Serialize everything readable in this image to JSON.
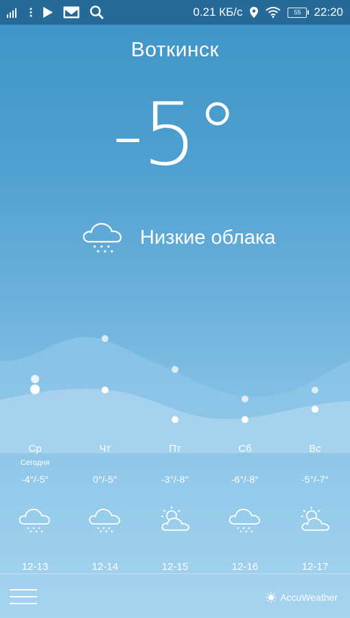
{
  "status_bar": {
    "speed": "0.21 КБ/с",
    "battery": "55",
    "time": "22:20",
    "icons": [
      "signal-icon",
      "more-icon",
      "play-store-icon",
      "gmail-icon",
      "search-icon",
      "location-icon",
      "wifi-icon",
      "battery-icon"
    ]
  },
  "weather": {
    "city": "Воткинск",
    "temperature": "-5°",
    "condition": "Низкие облака",
    "condition_icon": "cloud-snow-icon"
  },
  "forecast": [
    {
      "day": "Ср",
      "sub": "Сегодня",
      "temp": "-4°/-5°",
      "icon": "cloud-snow-icon",
      "date": "12-13"
    },
    {
      "day": "Чт",
      "sub": "",
      "temp": "0°/-5°",
      "icon": "cloud-snow-icon",
      "date": "12-14"
    },
    {
      "day": "Пт",
      "sub": "",
      "temp": "-3°/-8°",
      "icon": "sun-cloud-icon",
      "date": "12-15"
    },
    {
      "day": "Сб",
      "sub": "",
      "temp": "-6°/-8°",
      "icon": "cloud-snow-icon",
      "date": "12-16"
    },
    {
      "day": "Вс",
      "sub": "",
      "temp": "-5°/-7°",
      "icon": "sun-cloud-icon",
      "date": "12-17"
    }
  ],
  "footer": {
    "brand": "AccuWeather",
    "menu_icon": "menu-icon"
  }
}
